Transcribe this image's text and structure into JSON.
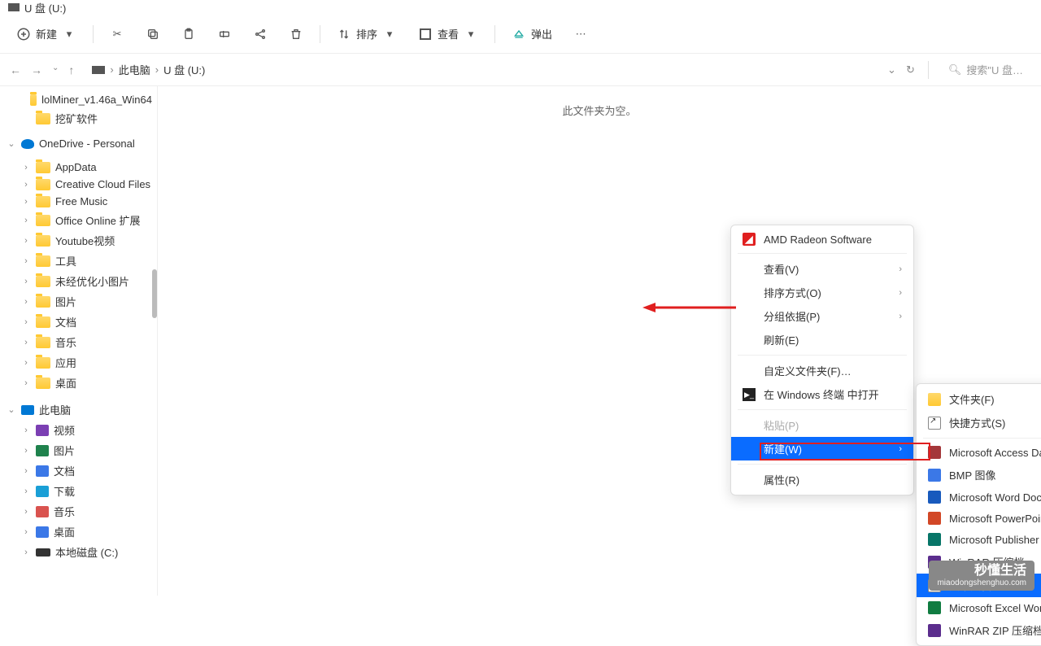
{
  "window": {
    "title": "U 盘 (U:)"
  },
  "toolbar": {
    "new": "新建",
    "sort": "排序",
    "view": "查看",
    "eject": "弹出"
  },
  "nav": {
    "breadcrumb_pc": "此电脑",
    "breadcrumb_drive": "U 盘 (U:)",
    "search_placeholder": "搜索\"U 盘…"
  },
  "sidebar": {
    "items": [
      {
        "type": "folder",
        "label": "lolMiner_v1.46a_Win64",
        "indent": 1
      },
      {
        "type": "folder",
        "label": "挖矿软件",
        "indent": 1
      },
      {
        "type": "onedrive",
        "label": "OneDrive - Personal",
        "indent": 0,
        "chev": "v"
      },
      {
        "type": "folder",
        "label": "AppData",
        "indent": 1,
        "chev": ">"
      },
      {
        "type": "folder",
        "label": "Creative Cloud Files",
        "indent": 1,
        "chev": ">"
      },
      {
        "type": "folder",
        "label": "Free Music",
        "indent": 1,
        "chev": ">"
      },
      {
        "type": "folder",
        "label": "Office Online 扩展",
        "indent": 1,
        "chev": ">"
      },
      {
        "type": "folder",
        "label": "Youtube视频",
        "indent": 1,
        "chev": ">"
      },
      {
        "type": "folder",
        "label": "工具",
        "indent": 1,
        "chev": ">"
      },
      {
        "type": "folder",
        "label": "未经优化小图片",
        "indent": 1,
        "chev": ">"
      },
      {
        "type": "folder",
        "label": "图片",
        "indent": 1,
        "chev": ">"
      },
      {
        "type": "folder",
        "label": "文档",
        "indent": 1,
        "chev": ">"
      },
      {
        "type": "folder",
        "label": "音乐",
        "indent": 1,
        "chev": ">"
      },
      {
        "type": "folder",
        "label": "应用",
        "indent": 1,
        "chev": ">"
      },
      {
        "type": "folder",
        "label": "桌面",
        "indent": 1,
        "chev": ">"
      },
      {
        "type": "pc",
        "label": "此电脑",
        "indent": 0,
        "chev": "v"
      },
      {
        "type": "lib",
        "label": "视频",
        "indent": 1,
        "color": "#7b3fb3",
        "chev": ">"
      },
      {
        "type": "lib",
        "label": "图片",
        "indent": 1,
        "color": "#1f824d",
        "chev": ">"
      },
      {
        "type": "lib",
        "label": "文档",
        "indent": 1,
        "color": "#3b78e7",
        "chev": ">"
      },
      {
        "type": "lib",
        "label": "下载",
        "indent": 1,
        "color": "#1a9fd6",
        "chev": ">"
      },
      {
        "type": "lib",
        "label": "音乐",
        "indent": 1,
        "color": "#d9534f",
        "chev": ">"
      },
      {
        "type": "lib",
        "label": "桌面",
        "indent": 1,
        "color": "#3b78e7",
        "chev": ">"
      },
      {
        "type": "disk",
        "label": "本地磁盘 (C:)",
        "indent": 1,
        "chev": ">"
      }
    ]
  },
  "content": {
    "empty": "此文件夹为空。"
  },
  "contextMenu": {
    "amd": "AMD Radeon Software",
    "view": "查看(V)",
    "sortby": "排序方式(O)",
    "groupby": "分组依据(P)",
    "refresh": "刷新(E)",
    "customize": "自定义文件夹(F)…",
    "terminal": "在 Windows 终端 中打开",
    "shortcut": "粘贴(P)",
    "new": "新建(W)",
    "properties": "属性(R)"
  },
  "newSubMenu": {
    "folder": "文件夹(F)",
    "shortcut": "快捷方式(S)",
    "access": "Microsoft Access Database",
    "bmp": "BMP 图像",
    "word": "Microsoft Word Document",
    "ppt": "Microsoft PowerPoint Presentation",
    "pub": "Microsoft Publisher Document",
    "rar": "WinRAR 压缩档",
    "txt": "文本文档",
    "xls": "Microsoft Excel Worksheet",
    "zip": "WinRAR ZIP 压缩档"
  },
  "watermark": {
    "title": "秒懂生活",
    "sub": "miaodongshenghuo.com"
  }
}
